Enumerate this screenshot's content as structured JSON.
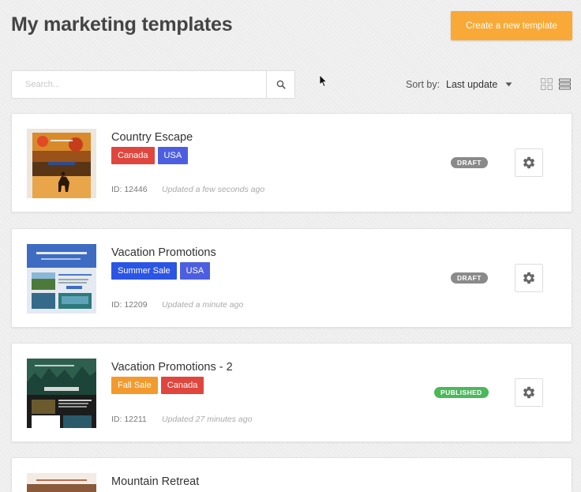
{
  "header": {
    "title": "My marketing templates",
    "create_label": "Create a new template"
  },
  "search": {
    "placeholder": "Search..."
  },
  "sort": {
    "label": "Sort by:",
    "value": "Last update"
  },
  "colors": {
    "accent": "#f9a937",
    "tag_red": "#e0463d",
    "tag_blue": "#4d5fe0",
    "tag_orange": "#f39a2e",
    "draft": "#8a8a8a",
    "published": "#4bb85a"
  },
  "templates": [
    {
      "title": "Country Escape",
      "tags": [
        {
          "label": "Canada",
          "color": "#e0463d"
        },
        {
          "label": "USA",
          "color": "#4d5fe0"
        }
      ],
      "id_text": "ID: 12446",
      "updated": "Updated a few seconds ago",
      "status": "DRAFT",
      "status_color": "#8a8a8a"
    },
    {
      "title": "Vacation Promotions",
      "tags": [
        {
          "label": "Summer Sale",
          "color": "#2b55e4"
        },
        {
          "label": "USA",
          "color": "#4d5fe0"
        }
      ],
      "id_text": "ID: 12209",
      "updated": "Updated a minute ago",
      "status": "DRAFT",
      "status_color": "#8a8a8a"
    },
    {
      "title": "Vacation Promotions - 2",
      "tags": [
        {
          "label": "Fall Sale",
          "color": "#f39a2e"
        },
        {
          "label": "Canada",
          "color": "#e0463d"
        }
      ],
      "id_text": "ID: 12211",
      "updated": "Updated 27 minutes ago",
      "status": "PUBLISHED",
      "status_color": "#4bb85a"
    },
    {
      "title": "Mountain Retreat"
    }
  ]
}
